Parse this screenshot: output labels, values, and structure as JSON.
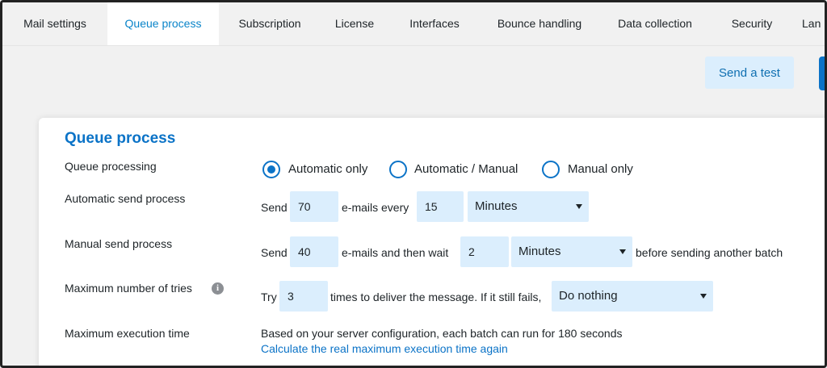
{
  "tabs": [
    {
      "label": "Mail settings"
    },
    {
      "label": "Queue process"
    },
    {
      "label": "Subscription"
    },
    {
      "label": "License"
    },
    {
      "label": "Interfaces"
    },
    {
      "label": "Bounce handling"
    },
    {
      "label": "Data collection"
    },
    {
      "label": "Security"
    },
    {
      "label": "Lan"
    }
  ],
  "toolbar": {
    "send_test_label": "Send a test"
  },
  "section": {
    "heading": "Queue process"
  },
  "rows": {
    "queue_processing": {
      "label": "Queue processing",
      "options": [
        "Automatic only",
        "Automatic / Manual",
        "Manual only"
      ],
      "selected": "Automatic only"
    },
    "automatic_send": {
      "label": "Automatic send process",
      "prefix": "Send",
      "count": "70",
      "middle": "e-mails every",
      "interval": "15",
      "unit": "Minutes"
    },
    "manual_send": {
      "label": "Manual send process",
      "prefix": "Send",
      "count": "40",
      "middle": "e-mails and then wait",
      "interval": "2",
      "unit": "Minutes",
      "suffix": "before sending another batch"
    },
    "max_tries": {
      "label": "Maximum number of tries",
      "prefix": "Try",
      "tries": "3",
      "middle": "times to deliver the message. If it still fails,",
      "action": "Do nothing"
    },
    "max_execution": {
      "label": "Maximum execution time",
      "description": "Based on your server configuration, each batch can run for 180 seconds",
      "link": "Calculate the real maximum execution time again"
    }
  },
  "colors": {
    "accent": "#0b73c7",
    "input_bg": "#dbeefd"
  }
}
